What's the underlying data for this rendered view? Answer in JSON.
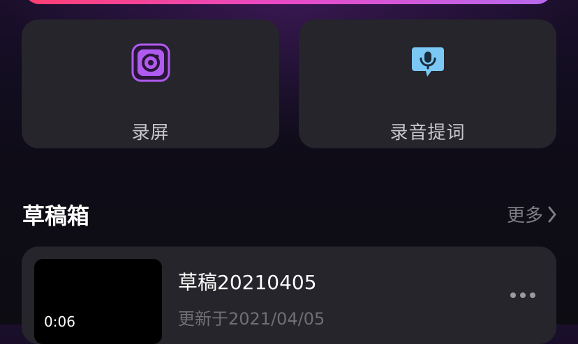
{
  "shortcuts": [
    {
      "label": "录屏",
      "icon": "screen-record-icon"
    },
    {
      "label": "录音提词",
      "icon": "microphone-icon"
    }
  ],
  "drafts": {
    "title": "草稿箱",
    "more_label": "更多",
    "items": [
      {
        "name": "草稿20210405",
        "updated": "更新于2021/04/05",
        "duration": "0:06"
      }
    ]
  },
  "colors": {
    "banner_gradient": [
      "#ff3f73",
      "#e84bc8",
      "#b76af0"
    ],
    "card_bg": "#25252b",
    "record_icon": "#b05bf0",
    "mic_icon": "#7bc8f6"
  }
}
